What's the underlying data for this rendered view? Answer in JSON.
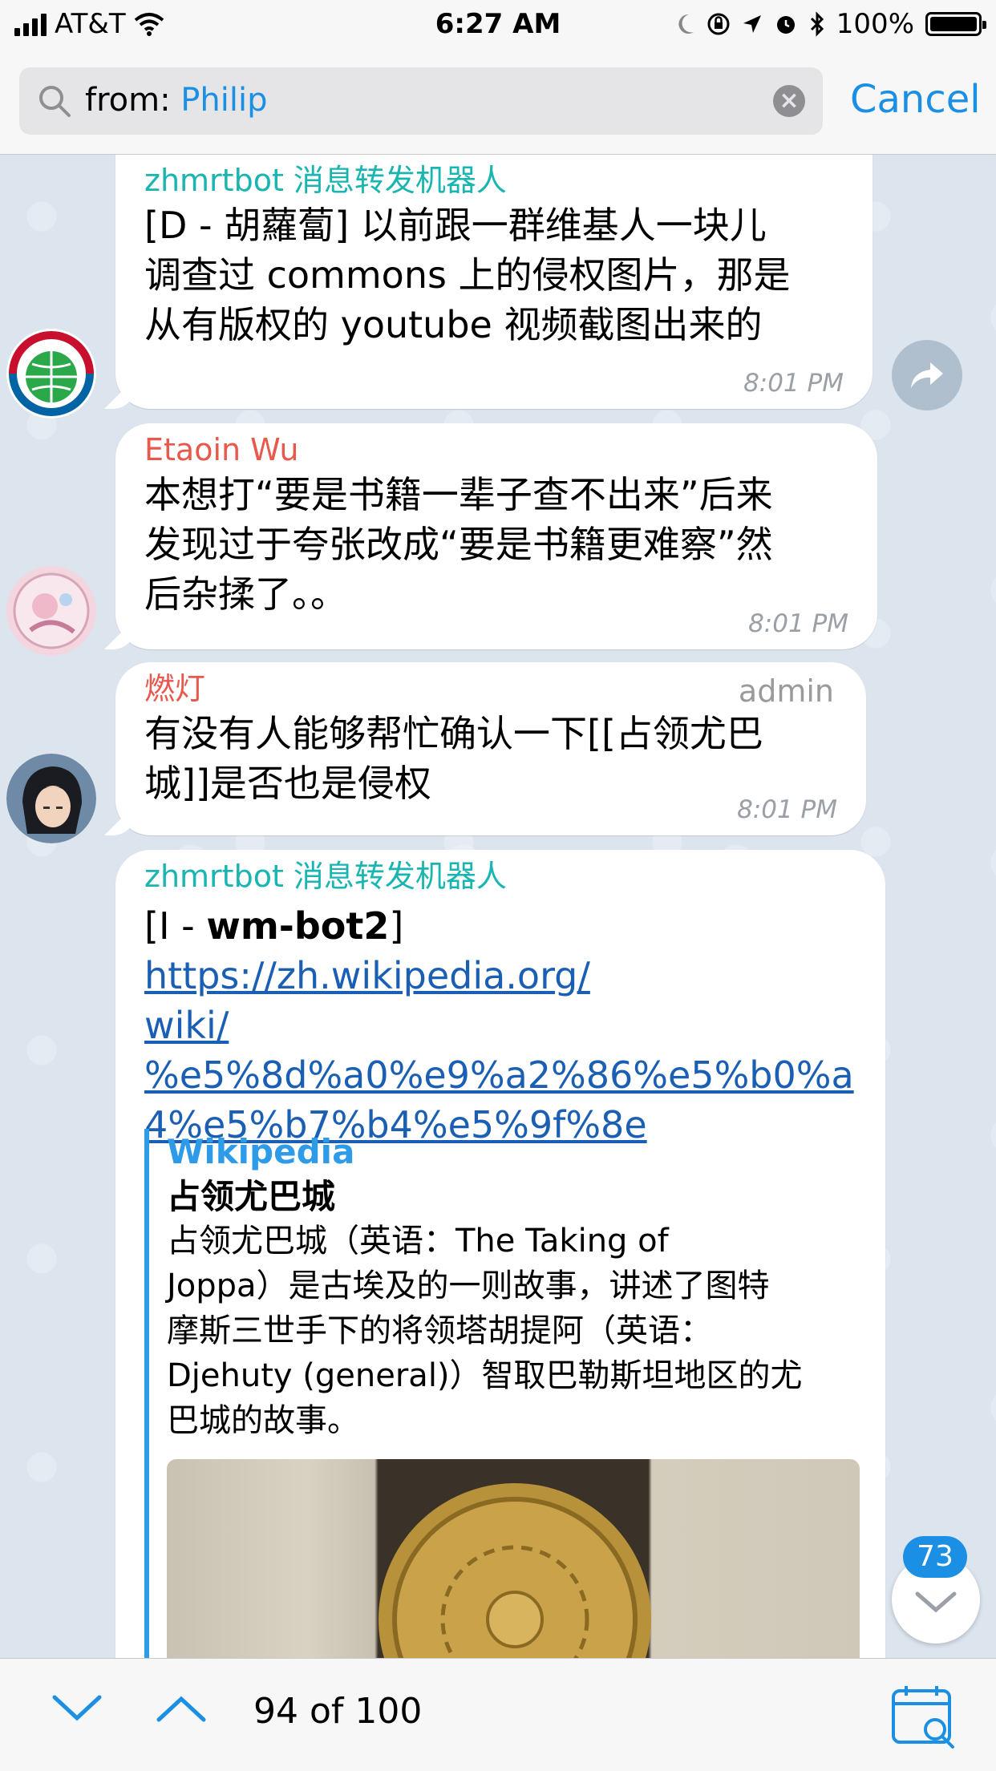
{
  "status_bar": {
    "carrier": "AT&T",
    "time": "6:27 AM",
    "battery": "100%",
    "battery_level": 1.0
  },
  "search": {
    "prefix": "from: ",
    "query": "Philip",
    "cancel_label": "Cancel"
  },
  "messages": [
    {
      "sender": "zhmrtbot 消息转发机器人",
      "text_lines": [
        "[D - 胡蘿蔔] 以前跟一群维基人一块儿",
        "调查过 commons 上的侵权图片，那是",
        "从有版权的 youtube 视频截图出来的"
      ],
      "time": "8:01 PM"
    },
    {
      "sender": "Etaoin Wu",
      "text_lines": [
        "本想打“要是书籍一辈子查不出来”后来",
        "发现过于夸张改成“要是书籍更难察”然",
        "后杂揉了。。"
      ],
      "time": "8:01 PM"
    },
    {
      "sender": "燃灯",
      "role": "admin",
      "text_lines": [
        "有没有人能够帮忙确认一下[[占领尤巴",
        "城]]是否也是侵权"
      ],
      "time": "8:01 PM"
    },
    {
      "sender": "zhmrtbot 消息转发机器人",
      "prefix": "[I - ",
      "bold_name": "wm-bot2",
      "suffix": "] ",
      "link_lines": [
        "https://zh.wikipedia.org/",
        "wiki/",
        "%e5%8d%a0%e9%a2%86%e5%b0%a",
        "4%e5%b7%b4%e5%9f%8e"
      ],
      "preview": {
        "site": "Wikipedia",
        "title": "占领尤巴城",
        "desc_lines": [
          "占领尤巴城（英语：The Taking of",
          "Joppa）是古埃及的一则故事，讲述了图特",
          "摩斯三世手下的将领塔胡提阿（英语：",
          "Djehuty (general)）智取巴勒斯坦地区的尤",
          "巴城的故事。"
        ]
      }
    }
  ],
  "scroll_badge": "73",
  "bottom_bar": {
    "counter": "94 of 100"
  }
}
